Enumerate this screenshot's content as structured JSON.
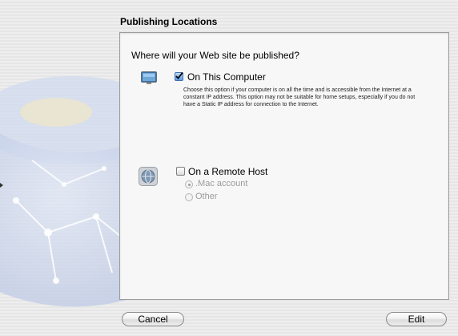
{
  "section": {
    "title": "Publishing Locations"
  },
  "panel": {
    "question": "Where will your Web site be published?",
    "on_this_computer": {
      "label": "On This Computer",
      "checked": true,
      "description": "Choose this option if your computer is on all the time and is accessible from the Internet at a constant IP address.  This option may not be suitable for home setups, especially if you do not have a Static IP address for connection to the Internet.",
      "icon": "computer-icon"
    },
    "remote_host": {
      "label": "On a Remote Host",
      "checked": false,
      "icon": "network-globe-icon",
      "options": [
        {
          "label": ".Mac account",
          "selected": true,
          "enabled": false
        },
        {
          "label": "Other",
          "selected": false,
          "enabled": false
        }
      ]
    }
  },
  "buttons": {
    "cancel": "Cancel",
    "edit": "Edit"
  },
  "colors": {
    "checkbox_checked": "#5a9be5",
    "disabled_text": "#9b9b9b",
    "panel_background": "#f7f7f7"
  }
}
